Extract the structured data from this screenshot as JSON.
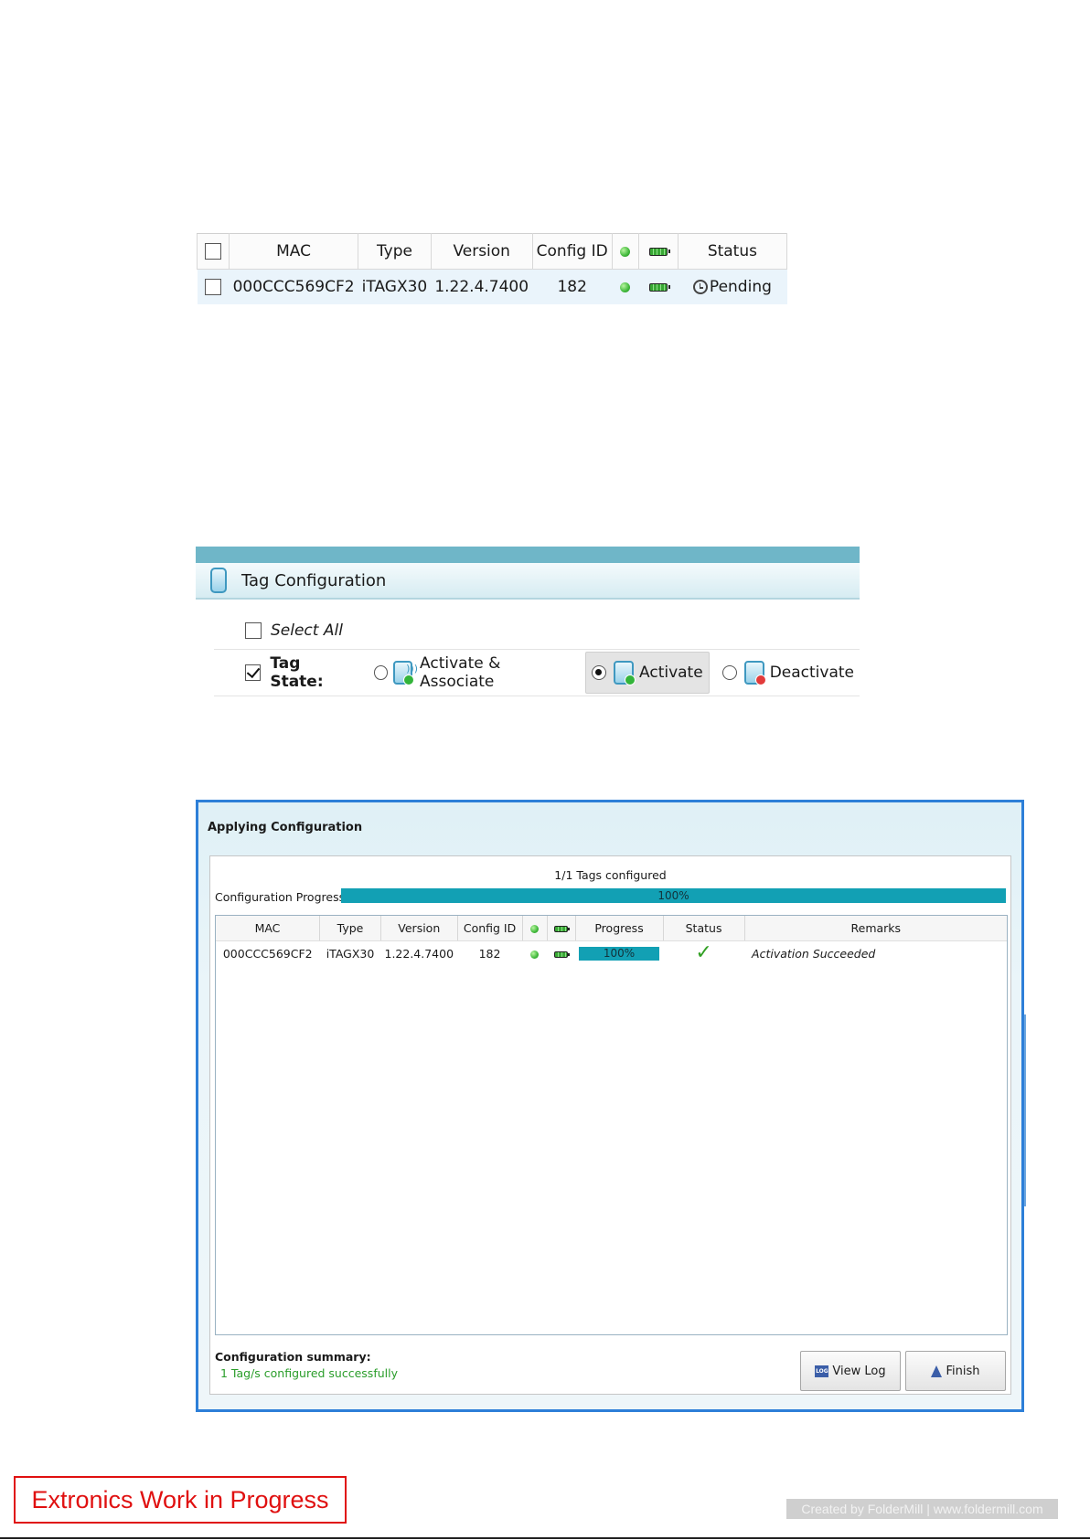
{
  "grid1": {
    "headers": {
      "mac": "MAC",
      "type": "Type",
      "version": "Version",
      "config_id": "Config ID",
      "status": "Status"
    },
    "row": {
      "mac": "000CCC569CF2",
      "type": "iTAGX30",
      "version": "1.22.4.7400",
      "config_id": "182",
      "status": "Pending"
    },
    "header_checked": false,
    "row_checked": false,
    "icons": {
      "status_dot": "green-dot-icon",
      "battery": "battery-icon",
      "pending": "clock-icon"
    }
  },
  "tag_config": {
    "title": "Tag Configuration",
    "select_all_label": "Select All",
    "select_all_checked": false,
    "tag_state_label": "Tag State:",
    "tag_state_checked": true,
    "options": [
      {
        "label": "Activate & Associate",
        "selected": false
      },
      {
        "label": "Activate",
        "selected": true
      },
      {
        "label": "Deactivate",
        "selected": false
      }
    ],
    "colors": {
      "topbar": "#6fb6c8",
      "activate_badge": "#33b43a",
      "deactivate_badge": "#e23b3b"
    }
  },
  "dialog": {
    "title": "Applying Configuration",
    "tags_configured": "1/1 Tags configured",
    "progress_label": "Configuration Progress:",
    "progress_value": 100,
    "progress_text": "100%",
    "headers": {
      "mac": "MAC",
      "type": "Type",
      "version": "Version",
      "config_id": "Config ID",
      "progress": "Progress",
      "status": "Status",
      "remarks": "Remarks"
    },
    "rows": [
      {
        "mac": "000CCC569CF2",
        "type": "iTAGX30",
        "version": "1.22.4.7400",
        "config_id": "182",
        "progress_text": "100%",
        "progress_value": 100,
        "status_icon": "check-icon",
        "remarks": "Activation Succeeded"
      }
    ],
    "summary_label": "Configuration summary:",
    "summary_value": "1 Tag/s configured successfully",
    "buttons": {
      "view_log": "View Log",
      "finish": "Finish"
    },
    "colors": {
      "border": "#2d7fd8",
      "progress": "#12a0b4",
      "success": "#2a9d2a"
    }
  },
  "footer": {
    "wip": "Extronics Work in Progress",
    "credit": "Created by FolderMill | www.foldermill.com"
  }
}
